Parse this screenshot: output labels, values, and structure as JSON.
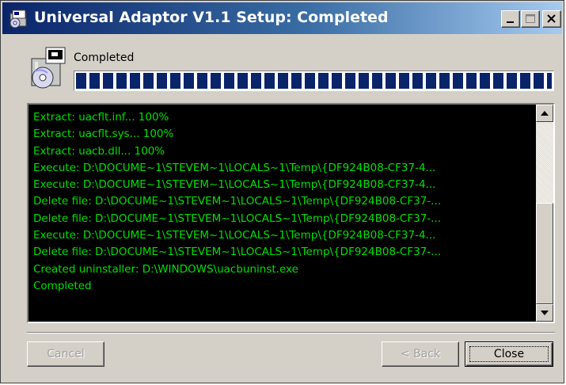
{
  "window": {
    "title": "Universal Adaptor V1.1 Setup: Completed",
    "controls": [
      "minimize-icon",
      "maximize-icon",
      "close-icon"
    ]
  },
  "status": {
    "label": "Completed",
    "progress": 1.0
  },
  "log": {
    "lines": [
      "Extract: uacflt.inf... 100%",
      "Extract: uacflt.sys... 100%",
      "Extract: uacb.dll... 100%",
      "Execute: D:\\DOCUME~1\\STEVEM~1\\LOCALS~1\\Temp\\{DF924B08-CF37-4...",
      "Execute: D:\\DOCUME~1\\STEVEM~1\\LOCALS~1\\Temp\\{DF924B08-CF37-4...",
      "Delete file: D:\\DOCUME~1\\STEVEM~1\\LOCALS~1\\Temp\\{DF924B08-CF37-...",
      "Delete file: D:\\DOCUME~1\\STEVEM~1\\LOCALS~1\\Temp\\{DF924B08-CF37-...",
      "Execute: D:\\DOCUME~1\\STEVEM~1\\LOCALS~1\\Temp\\{DF924B08-CF37-4...",
      "Delete file: D:\\DOCUME~1\\STEVEM~1\\LOCALS~1\\Temp\\{DF924B08-CF37-...",
      "Created uninstaller: D:\\WINDOWS\\uacbuninst.exe",
      "Completed"
    ],
    "text_color": "#00e000",
    "background": "#000000"
  },
  "buttons": {
    "cancel": "Cancel",
    "back": "< Back",
    "close": "Close"
  },
  "colors": {
    "titlebar_start": "#0a246a",
    "titlebar_end": "#a6caf0",
    "progress_block": "#0a246a",
    "face": "#d4d0c8"
  }
}
